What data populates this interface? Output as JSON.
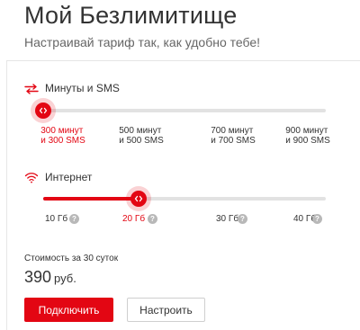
{
  "header": {
    "title": "Мой Безлимитище",
    "subtitle": "Настраивай тариф так, как удобно тебе!"
  },
  "minutes_sms": {
    "label": "Минуты и SMS",
    "icon": "arrows-swap-icon",
    "selected_index": 0,
    "options": [
      {
        "line1": "300 минут",
        "line2": "и 300 SMS"
      },
      {
        "line1": "500 минут",
        "line2": "и 500 SMS"
      },
      {
        "line1": "700 минут",
        "line2": "и 700 SMS"
      },
      {
        "line1": "900 минут",
        "line2": "и 900 SMS"
      }
    ]
  },
  "internet": {
    "label": "Интернет",
    "icon": "wifi-icon",
    "selected_index": 1,
    "options": [
      "10 Гб",
      "20 Гб",
      "30 Гб",
      "40 Гб"
    ],
    "info_glyph": "?"
  },
  "pricing": {
    "cost_label": "Стоимость за 30 суток",
    "price": "390",
    "currency": "руб."
  },
  "actions": {
    "connect_label": "Подключить",
    "configure_label": "Настроить"
  },
  "colors": {
    "accent": "#e30613",
    "track": "#e2e2e2",
    "text": "#333333",
    "muted": "#666666"
  }
}
